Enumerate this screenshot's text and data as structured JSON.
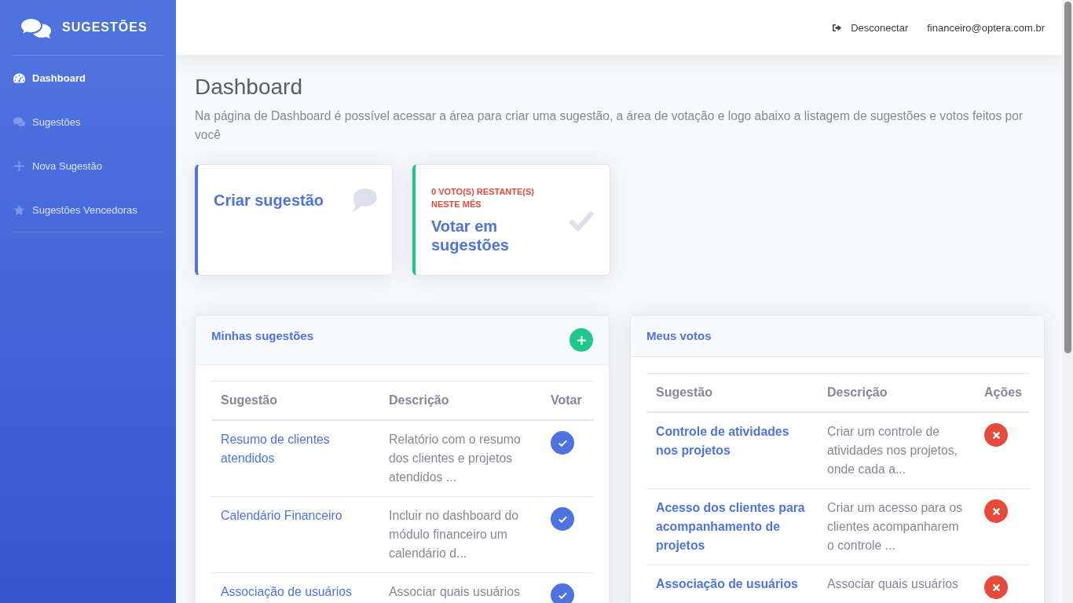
{
  "sidebar": {
    "brand": "SUGESTÕES",
    "items": [
      {
        "label": "Dashboard",
        "selected": true
      },
      {
        "label": "Sugestões",
        "selected": false
      },
      {
        "label": "Nova Sugestão",
        "selected": false
      },
      {
        "label": "Sugestões Vencedoras",
        "selected": false
      }
    ]
  },
  "topbar": {
    "logout": "Desconectar",
    "user": "financeiro@optera.com.br"
  },
  "page": {
    "title": "Dashboard",
    "description": "Na página de Dashboard é possível acessar a área para criar uma sugestão, a área de votação e logo abaixo a listagem de sugestões e votos feitos por você"
  },
  "cards": [
    {
      "kind": "create",
      "title": "Criar sugestão"
    },
    {
      "kind": "vote",
      "note": "0 VOTO(S) RESTANTE(S) NESTE MÊS",
      "title": "Votar em sugestões"
    }
  ],
  "panels": [
    {
      "kind": "suggestions",
      "title": "Minhas sugestões",
      "columns": [
        "Sugestão",
        "Descrição",
        "Votar"
      ],
      "rows": [
        {
          "title": "Resumo de clientes atendidos",
          "description": "Relatório com o resumo dos clientes e projetos atendidos ..."
        },
        {
          "title": "Calendário Financeiro",
          "description": "Incluir no dashboard do módulo financeiro um calendário d..."
        },
        {
          "title": "Associação de usuários",
          "description": "Associar quais usuários"
        }
      ]
    },
    {
      "kind": "votes",
      "title": "Meus votos",
      "columns": [
        "Sugestão",
        "Descrição",
        "Ações"
      ],
      "rows": [
        {
          "title": "Controle de atividades nos projetos",
          "description": "Criar um controle de atividades nos projetos, onde cada a..."
        },
        {
          "title": "Acesso dos clientes para acompanhamento de projetos",
          "description": "Criar um acesso para os clientes acompanharem o controle ..."
        },
        {
          "title": "Associação de usuários",
          "description": "Associar quais usuários"
        }
      ]
    }
  ]
}
